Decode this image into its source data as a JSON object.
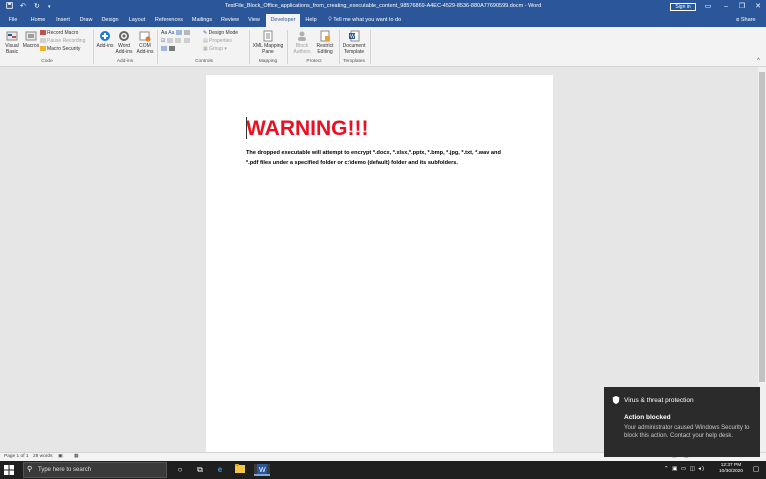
{
  "window": {
    "title": "TestFile_Block_Office_applications_from_creating_executable_content_98576869-A4EC-4529-8536-880A77690599.docm  -  Word",
    "sign_in": "Sign in",
    "share": "Share"
  },
  "tabs": [
    "File",
    "Home",
    "Insert",
    "Draw",
    "Design",
    "Layout",
    "References",
    "Mailings",
    "Review",
    "View",
    "Developer",
    "Help"
  ],
  "active_tab": "Developer",
  "tell_me": "Tell me what you want to do",
  "ribbon": {
    "code": {
      "label": "Code",
      "visual_basic": "Visual Basic",
      "macros": "Macros",
      "record_macro": "Record Macro",
      "pause_recording": "Pause Recording",
      "macro_security": "Macro Security"
    },
    "addins": {
      "label": "Add-ins",
      "addins": "Add-ins",
      "word_addins": "Word Add-ins",
      "com_addins": "COM Add-ins"
    },
    "controls": {
      "label": "Controls",
      "design_mode": "Design Mode",
      "properties": "Properties",
      "group": "Group"
    },
    "mapping": {
      "label": "Mapping",
      "xml_mapping": "XML Mapping Pane"
    },
    "protect": {
      "label": "Protect",
      "block_authors": "Block Authors",
      "restrict_editing": "Restrict Editing"
    },
    "templates": {
      "label": "Templates",
      "document_template": "Document Template"
    }
  },
  "document": {
    "heading": "WARNING!!!",
    "body": "The dropped executable will attempt to encrypt *.docx, *.xlsx,*.pptx, *.bmp, *.jpg, *.txt, *.wav and *.pdf files under a specified folder or c:\\demo (default) folder and its subfolders."
  },
  "status": {
    "page": "Page 1 of 1",
    "words": "28 words"
  },
  "taskbar": {
    "search_placeholder": "Type here to search",
    "time": "12:37 PM",
    "date": "10/30/2020"
  },
  "toast": {
    "app": "Virus & threat protection",
    "title": "Action blocked",
    "message": "Your administrator caused Windows Security to block this action. Contact your help desk."
  },
  "colors": {
    "word_blue": "#2b579a",
    "warning_red": "#e81123",
    "taskbar": "#1f1f1f",
    "toast": "#2b2b2b"
  },
  "icons": [
    "save-icon",
    "undo-icon",
    "redo-icon",
    "lightbulb-icon",
    "search-icon",
    "windows-start-icon",
    "task-view-icon",
    "edge-icon",
    "file-explorer-icon",
    "word-icon",
    "shield-icon",
    "notification-icon"
  ]
}
